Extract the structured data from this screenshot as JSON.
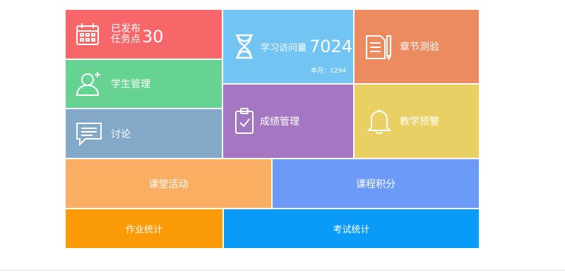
{
  "tiles": {
    "tasks": {
      "line1": "已发布",
      "line2": "任务点",
      "count": "30",
      "icon": "calendar-icon",
      "color": "#f7676a"
    },
    "visits": {
      "label": "学习访问量",
      "count": "7024",
      "month_label": "本月：1294",
      "icon": "hourglass-icon",
      "color": "#72c4f3"
    },
    "quiz": {
      "label": "章节测验",
      "icon": "document-pen-icon",
      "color": "#ec8b5f"
    },
    "students": {
      "label": "学生管理",
      "icon": "add-user-icon",
      "color": "#67d393"
    },
    "grades": {
      "label": "成绩管理",
      "icon": "clipboard-check-icon",
      "color": "#a577c2"
    },
    "warning": {
      "label": "教学预警",
      "icon": "bell-icon",
      "color": "#ead064"
    },
    "discussion": {
      "label": "讨论",
      "icon": "chat-icon",
      "color": "#83a8c8"
    },
    "class_activity": {
      "label": "课堂活动",
      "color": "#f9ae62"
    },
    "course_points": {
      "label": "课程积分",
      "color": "#6b9bf6"
    },
    "homework": {
      "label": "作业统计",
      "color": "#f99a06"
    },
    "exam": {
      "label": "考试统计",
      "color": "#0a9bf8"
    }
  }
}
